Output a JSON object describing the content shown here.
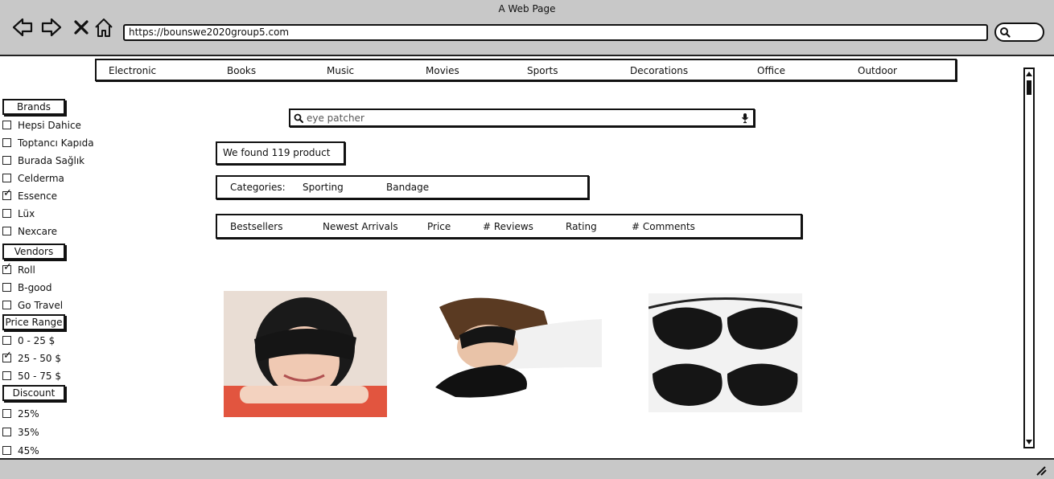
{
  "browser": {
    "title": "A Web Page",
    "url": "https://bounswe2020group5.com"
  },
  "categories_nav": [
    "Electronic",
    "Books",
    "Music",
    "Movies",
    "Sports",
    "Decorations",
    "Office",
    "Outdoor"
  ],
  "sidebar": {
    "brands": {
      "title": "Brands",
      "options": [
        {
          "label": "Hepsi Dahice",
          "checked": false
        },
        {
          "label": "Toptancı Kapıda",
          "checked": false
        },
        {
          "label": "Burada Sağlık",
          "checked": false
        },
        {
          "label": "Celderma",
          "checked": false
        },
        {
          "label": "Essence",
          "checked": true
        },
        {
          "label": "Lüx",
          "checked": false
        },
        {
          "label": "Nexcare",
          "checked": false
        }
      ]
    },
    "vendors": {
      "title": "Vendors",
      "options": [
        {
          "label": "Roll",
          "checked": true
        },
        {
          "label": "B-good",
          "checked": false
        },
        {
          "label": "Go Travel",
          "checked": false
        }
      ]
    },
    "price": {
      "title": "Price Range",
      "options": [
        {
          "label": "0 - 25 $",
          "checked": false
        },
        {
          "label": "25 - 50 $",
          "checked": true
        },
        {
          "label": "50 - 75 $",
          "checked": false
        }
      ]
    },
    "discount": {
      "title": "Discount",
      "options": [
        {
          "label": "25%",
          "checked": false
        },
        {
          "label": "35%",
          "checked": false
        },
        {
          "label": "45%",
          "checked": false
        }
      ]
    }
  },
  "search": {
    "value": "eye patcher",
    "placeholder": "eye patcher"
  },
  "results": {
    "found_text": "We found 119 product"
  },
  "category_filter": {
    "label": "Categories:",
    "items": [
      "Sporting",
      "Bandage"
    ]
  },
  "sort_bar": [
    "Bestsellers",
    "Newest Arrivals",
    "Price",
    "# Reviews",
    "Rating",
    "# Comments"
  ],
  "products": [
    {
      "name": "eye-mask-girl"
    },
    {
      "name": "eye-mask-sleeping-woman"
    },
    {
      "name": "eye-mask-set-of-four"
    }
  ],
  "colors": {
    "chrome": "#c8c8c8",
    "ink": "#111111",
    "mask": "#151515",
    "bg_pink": "#e9ddd4"
  }
}
